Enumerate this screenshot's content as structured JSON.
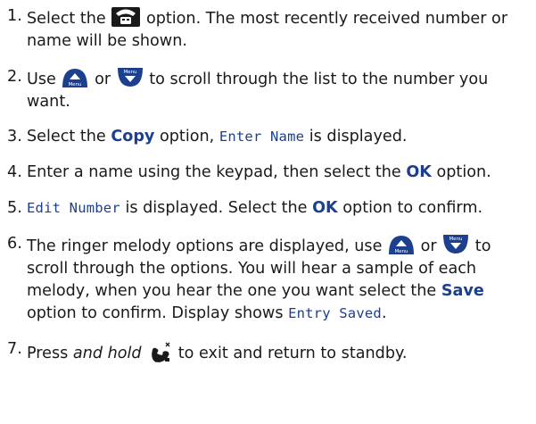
{
  "steps": [
    {
      "num": "1.",
      "t1": "Select the",
      "icon": "phone-book-icon",
      "t2": "option. The most recently received number or name will be shown."
    },
    {
      "num": "2.",
      "t1": "Use",
      "icon1": "scroll-up-button-icon",
      "t2": "or",
      "icon2": "menu-scroll-down-button-icon",
      "t3": "to scroll through the list to the number you want."
    },
    {
      "num": "3.",
      "t1": "Select the",
      "bold1": "Copy",
      "t2": "option,",
      "lcd1": "Enter Name",
      "t3": "is displayed."
    },
    {
      "num": "4.",
      "t1": "Enter a name using the keypad, then select the",
      "bold1": "OK",
      "t2": "option."
    },
    {
      "num": "5.",
      "lcd1": "Edit Number",
      "t1": "is displayed. Select the",
      "bold1": "OK",
      "t2": "option to confirm."
    },
    {
      "num": "6.",
      "t1": "The ringer melody options are displayed, use",
      "icon1": "scroll-up-button-icon",
      "t2": "or",
      "icon2": "menu-scroll-down-button-icon",
      "t3": "to scroll through the options. You will hear a sample of each melody, when you hear the one you want select the",
      "bold1": "Save",
      "t4": "option to confirm. Display shows",
      "lcd1": "Entry Saved",
      "t5": "."
    },
    {
      "num": "7.",
      "t1": "Press",
      "italic1": "and hold",
      "icon": "end-call-icon",
      "t2": "to exit and return to standby."
    }
  ],
  "icon_labels": {
    "menu": "Menu"
  },
  "colors": {
    "accent": "#1c3f8e",
    "text": "#1a1a1a",
    "icon_fill": "#1c3f8e",
    "icon_dark": "#1a1a1a"
  }
}
